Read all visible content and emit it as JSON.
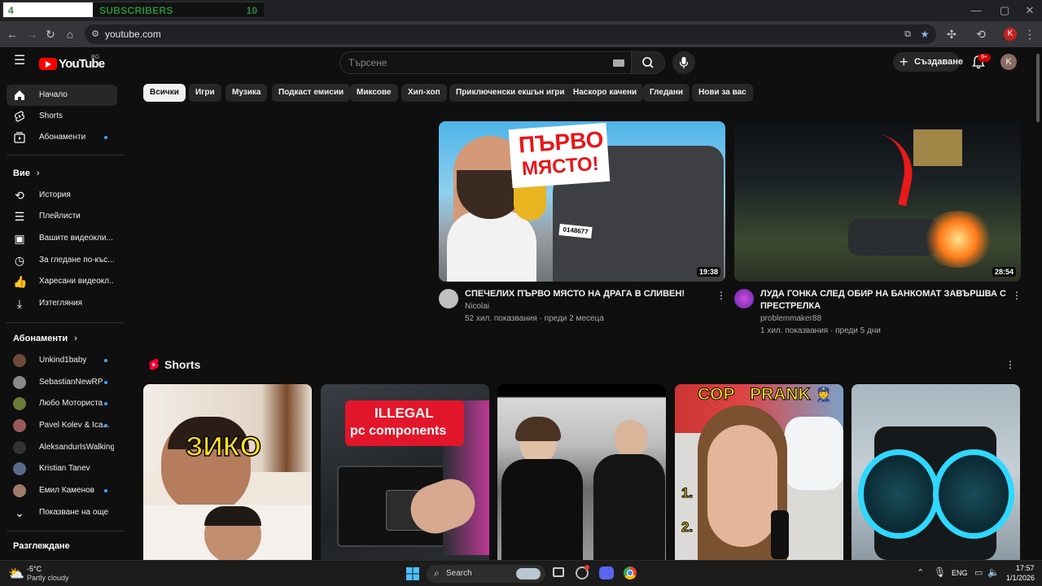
{
  "overlay": {
    "left_number": "4",
    "label": "SUBSCRIBERS",
    "right_number": "10"
  },
  "browser": {
    "url": "youtube.com",
    "profile_initial": "K"
  },
  "header": {
    "logo_text": "YouTube",
    "country": "BG",
    "search_placeholder": "Търсене",
    "create_label": "Създаване",
    "notifications": "9+",
    "avatar_initial": "K"
  },
  "sidebar": {
    "main": [
      {
        "label": "Начало",
        "icon": "home-icon"
      },
      {
        "label": "Shorts",
        "icon": "shorts-icon"
      },
      {
        "label": "Абонаменти",
        "icon": "subscriptions-icon"
      }
    ],
    "you_heading": "Вие",
    "you": [
      {
        "label": "История",
        "icon": "history-icon"
      },
      {
        "label": "Плейлисти",
        "icon": "playlists-icon"
      },
      {
        "label": "Вашите видеокли...",
        "icon": "your-videos-icon"
      },
      {
        "label": "За гледане по-къс...",
        "icon": "watch-later-icon"
      },
      {
        "label": "Харесани видеокл...",
        "icon": "liked-icon"
      },
      {
        "label": "Изтегляния",
        "icon": "downloads-icon"
      }
    ],
    "subs_heading": "Абонаменти",
    "subs": [
      {
        "label": "Unkind1baby",
        "color": "#6b4a3a"
      },
      {
        "label": "SebastianNewRP",
        "color": "#8a8a8a"
      },
      {
        "label": "Любо Моториста",
        "color": "#6c7a3a"
      },
      {
        "label": "Pavel Kolev & Ica...",
        "color": "#9a5a5a"
      },
      {
        "label": "AleksandurIsWalking",
        "color": "#333333"
      },
      {
        "label": "Kristian Tanev",
        "color": "#5a6a8a"
      },
      {
        "label": "Емил Каменов",
        "color": "#a07a6a"
      }
    ],
    "show_more": "Показване на още",
    "explore_heading": "Разглеждане"
  },
  "chips": [
    "Всички",
    "Игри",
    "Музика",
    "Подкаст емисии",
    "Миксове",
    "Хип-хоп",
    "Приключенски екшън игри",
    "Наскоро качени",
    "Гледани",
    "Нови за вас"
  ],
  "videos": [
    {
      "title": "СПЕЧЕЛИХ ПЪРВО МЯСТО НА ДРАГА В СЛИВЕН!",
      "channel": "Nicolai",
      "meta": "52 хил. показвания · преди 2 месеца",
      "duration": "19:38",
      "thumb_text_1": "ПЪРВО",
      "thumb_text_2": "МЯСТО!",
      "plate": "0148677"
    },
    {
      "title_1": "ЛУДА ГОНКА СЛЕД ОБИР НА БАНКОМАТ ЗАВЪРШВА С",
      "title_2": "ПРЕСТРЕЛКА",
      "channel": "problemmaker88",
      "meta": "1 хил. показвания · преди 5 дни",
      "duration": "28:54"
    }
  ],
  "shorts_section": {
    "title": "Shorts",
    "items": [
      {
        "overlay": "ЗИКО"
      },
      {
        "overlay_1": "ILLEGAL",
        "overlay_2": "pc components"
      },
      {
        "overlay": ""
      },
      {
        "overlay_1": "COP",
        "overlay_2": "PRANK",
        "list_1": "1.",
        "list_2": "2."
      },
      {
        "overlay": ""
      }
    ]
  },
  "taskbar": {
    "temp": "-5°C",
    "weather": "Partly cloudy",
    "search": "Search",
    "lang": "ENG",
    "time": "17:57",
    "date": "1/1/2026"
  }
}
